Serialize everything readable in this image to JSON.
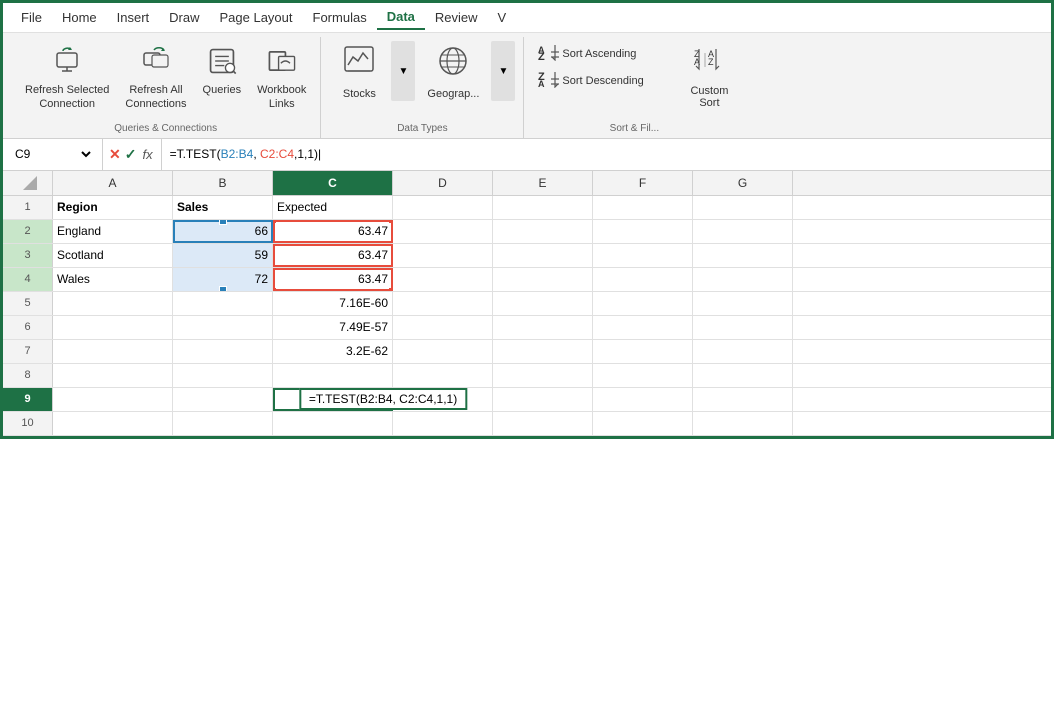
{
  "menu": {
    "items": [
      "File",
      "Home",
      "Insert",
      "Draw",
      "Page Layout",
      "Formulas",
      "Data",
      "Review",
      "V"
    ],
    "active": "Data"
  },
  "ribbon": {
    "groups": [
      {
        "name": "Queries & Connections",
        "label": "Queries & Connections",
        "items": [
          {
            "id": "refresh-selected",
            "label": "Refresh Selected\nConnection",
            "icon": "refresh-selected-icon"
          },
          {
            "id": "refresh-all",
            "label": "Refresh All\nConnections",
            "icon": "refresh-all-icon"
          },
          {
            "id": "queries",
            "label": "Queries",
            "icon": "queries-icon"
          },
          {
            "id": "workbook-links",
            "label": "Workbook\nLinks",
            "icon": "workbook-links-icon"
          }
        ]
      },
      {
        "name": "Data Types",
        "label": "Data Types",
        "items": [
          {
            "id": "stocks",
            "label": "Stocks",
            "icon": "stocks-icon"
          },
          {
            "id": "geography",
            "label": "Geograp...",
            "icon": "geography-icon"
          }
        ]
      },
      {
        "name": "Sort & Filter",
        "label": "Sort & Fil...",
        "items": [
          {
            "id": "sort-ascending",
            "label": "Sort Ascending",
            "icon": "sort-asc-icon"
          },
          {
            "id": "sort-descending",
            "label": "Sort Descending",
            "icon": "sort-desc-icon"
          },
          {
            "id": "custom-sort",
            "label": "Custom\nSort",
            "icon": "custom-sort-icon"
          }
        ]
      }
    ]
  },
  "formula_bar": {
    "cell_ref": "C9",
    "formula": "=T.TEST(B2:B4, C2:C4,1,1)",
    "formula_prefix": "=T.TEST(",
    "formula_b": "B2:B4",
    "formula_mid": ", ",
    "formula_c": "C2:C4",
    "formula_suffix": ",1,1)"
  },
  "columns": {
    "headers": [
      "",
      "A",
      "B",
      "C",
      "D",
      "E",
      "F",
      "G"
    ],
    "widths": [
      50,
      120,
      100,
      120,
      100,
      100,
      100,
      100
    ]
  },
  "rows": [
    {
      "num": "1",
      "cells": [
        {
          "val": "Region",
          "bold": true
        },
        {
          "val": "Sales",
          "bold": true
        },
        {
          "val": "Expected",
          "bold": false
        },
        {
          "val": ""
        },
        {
          "val": ""
        },
        {
          "val": ""
        },
        {
          "val": ""
        }
      ]
    },
    {
      "num": "2",
      "cells": [
        {
          "val": "England"
        },
        {
          "val": "66",
          "align": "right",
          "selected": true
        },
        {
          "val": "63.47",
          "align": "right",
          "red_outline": true
        },
        {
          "val": ""
        },
        {
          "val": ""
        },
        {
          "val": ""
        },
        {
          "val": ""
        }
      ]
    },
    {
      "num": "3",
      "cells": [
        {
          "val": "Scotland"
        },
        {
          "val": "59",
          "align": "right",
          "selected": true
        },
        {
          "val": "63.47",
          "align": "right",
          "red_outline": true
        },
        {
          "val": ""
        },
        {
          "val": ""
        },
        {
          "val": ""
        },
        {
          "val": ""
        }
      ]
    },
    {
      "num": "4",
      "cells": [
        {
          "val": "Wales"
        },
        {
          "val": "72",
          "align": "right",
          "selected": true
        },
        {
          "val": "63.47",
          "align": "right",
          "red_outline": true
        },
        {
          "val": ""
        },
        {
          "val": ""
        },
        {
          "val": ""
        },
        {
          "val": ""
        }
      ]
    },
    {
      "num": "5",
      "cells": [
        {
          "val": ""
        },
        {
          "val": ""
        },
        {
          "val": "7.16E-60",
          "align": "right"
        },
        {
          "val": ""
        },
        {
          "val": ""
        },
        {
          "val": ""
        },
        {
          "val": ""
        }
      ]
    },
    {
      "num": "6",
      "cells": [
        {
          "val": ""
        },
        {
          "val": ""
        },
        {
          "val": "7.49E-57",
          "align": "right"
        },
        {
          "val": ""
        },
        {
          "val": ""
        },
        {
          "val": ""
        },
        {
          "val": ""
        }
      ]
    },
    {
      "num": "7",
      "cells": [
        {
          "val": ""
        },
        {
          "val": ""
        },
        {
          "val": "3.2E-62",
          "align": "right"
        },
        {
          "val": ""
        },
        {
          "val": ""
        },
        {
          "val": ""
        },
        {
          "val": ""
        }
      ]
    },
    {
      "num": "8",
      "cells": [
        {
          "val": ""
        },
        {
          "val": ""
        },
        {
          "val": ""
        },
        {
          "val": ""
        },
        {
          "val": ""
        },
        {
          "val": ""
        },
        {
          "val": ""
        }
      ]
    },
    {
      "num": "9",
      "cells": [
        {
          "val": ""
        },
        {
          "val": ""
        },
        {
          "val": "",
          "active": true,
          "formula_tooltip": "=T.TEST(B2:B4, C2:C4,1,1)"
        },
        {
          "val": ""
        },
        {
          "val": ""
        },
        {
          "val": ""
        },
        {
          "val": ""
        }
      ]
    },
    {
      "num": "10",
      "cells": [
        {
          "val": ""
        },
        {
          "val": ""
        },
        {
          "val": ""
        },
        {
          "val": ""
        },
        {
          "val": ""
        },
        {
          "val": ""
        },
        {
          "val": ""
        }
      ]
    }
  ],
  "colors": {
    "green": "#1e7145",
    "blue": "#2980b9",
    "red": "#e74c3c",
    "selected_bg": "#dce9f7",
    "active_header": "#1e7145"
  }
}
